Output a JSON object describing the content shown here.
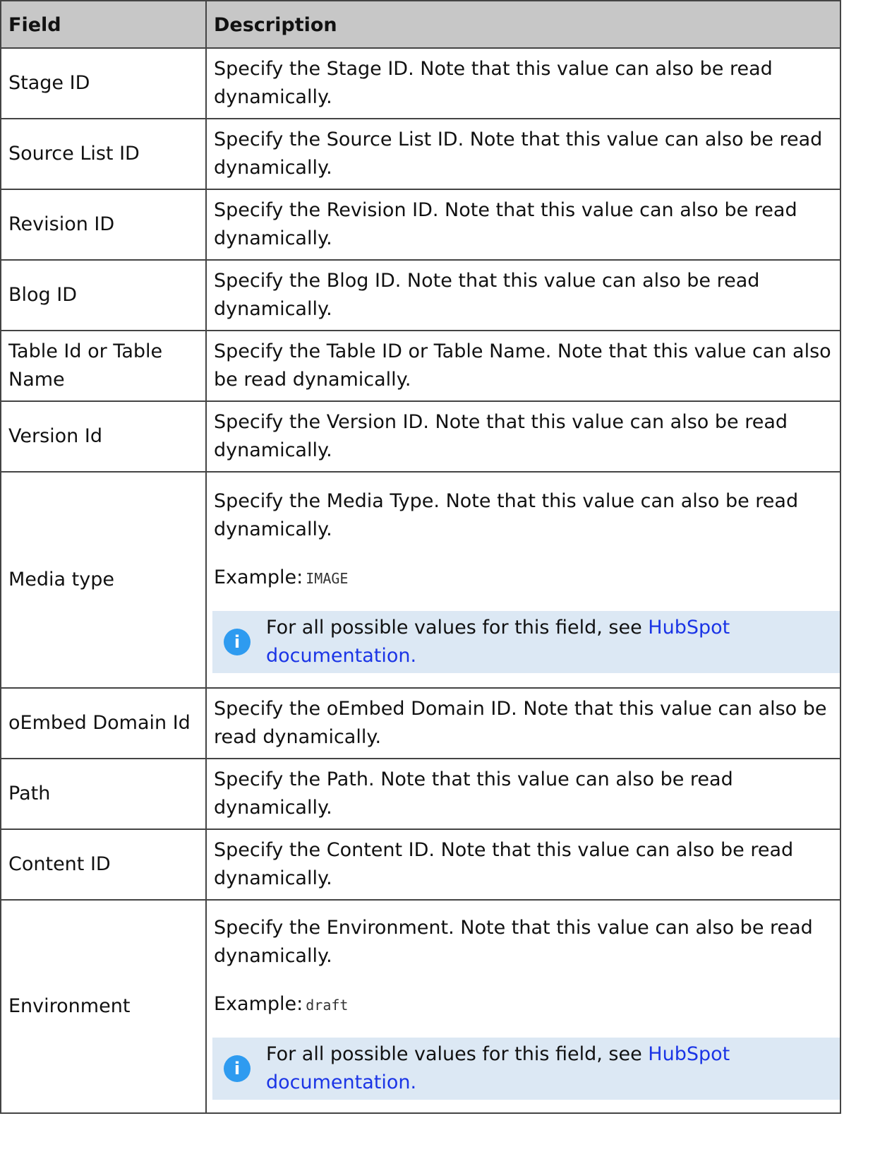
{
  "table": {
    "headers": [
      "Field",
      "Description"
    ],
    "rows": [
      {
        "field": "Stage ID",
        "description": "Specify the Stage ID. Note that this value can also be read dynamically."
      },
      {
        "field": "Source List ID",
        "description": "Specify the Source List ID. Note that this value can also be read dynamically."
      },
      {
        "field": "Revision ID",
        "description": "Specify the Revision ID. Note that this value can also be read dynamically."
      },
      {
        "field": "Blog ID",
        "description": "Specify the Blog ID. Note that this value can also be read dynamically."
      },
      {
        "field": "Table Id or Table Name",
        "description": "Specify the Table ID or Table Name. Note that this value can also be read dynamically."
      },
      {
        "field": "Version Id",
        "description": "Specify the Version ID. Note that this value can also be read dynamically."
      },
      {
        "field": "Media type",
        "description": "Specify the Media Type. Note that this value can also be read dynamically.",
        "example_label": "Example:",
        "example_value": "IMAGE",
        "note_text": "For all possible values for this field, see ",
        "note_link": "HubSpot documentation."
      },
      {
        "field": "oEmbed Domain Id",
        "description": "Specify the oEmbed Domain ID. Note that this value can also be read dynamically."
      },
      {
        "field": "Path",
        "description": "Specify the Path. Note that this value can also be read dynamically."
      },
      {
        "field": "Content ID",
        "description": "Specify the Content ID. Note that this value can also be read dynamically."
      },
      {
        "field": "Environment",
        "description": "Specify the Environment. Note that this value can also be read dynamically.",
        "example_label": "Example:",
        "example_value": "draft",
        "note_text": "For all possible values for this field, see ",
        "note_link": "HubSpot documentation."
      }
    ]
  },
  "info_icon_glyph": "i",
  "colors": {
    "header_bg": "#c7c7c7",
    "note_bg": "#dce8f4",
    "info_icon": "#2e9bf0",
    "link": "#1a34e6"
  }
}
